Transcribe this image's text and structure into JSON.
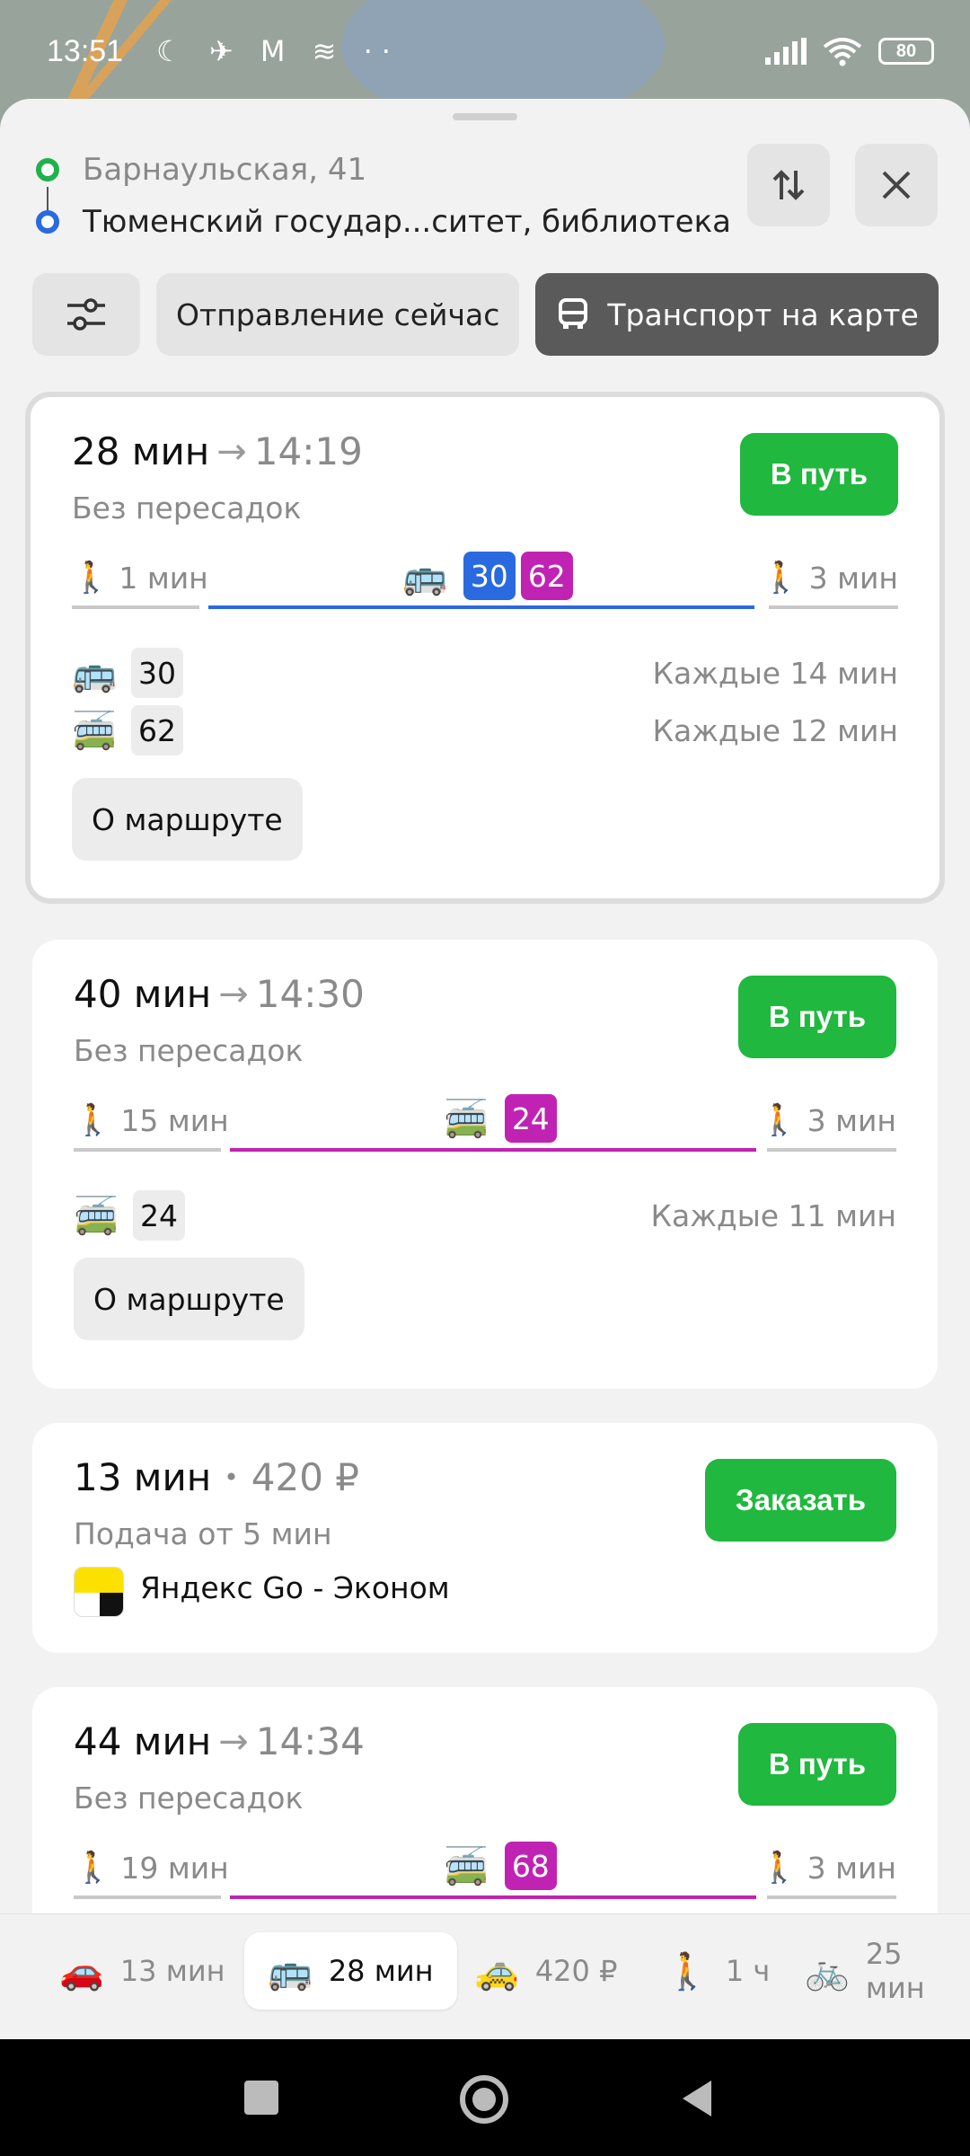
{
  "status_bar": {
    "time": "13:51",
    "left_icons": "☾ ✈ M ≋ ··",
    "battery": "80"
  },
  "route": {
    "from": "Барнаульская, 41",
    "to": "Тюменский государ...ситет, библиотека"
  },
  "icons": {
    "swap": "swap-vertical-icon",
    "close": "close-icon",
    "filters": "filters-icon",
    "bus": "bus-icon",
    "trolleybus": "trolleybus-icon",
    "walk": "walk-icon",
    "car": "car-icon",
    "taxi": "taxi-icon",
    "bike": "bike-icon"
  },
  "chips": {
    "departure": "Отправление сейчас",
    "transport_on_map": "Транспорт на карте"
  },
  "colors": {
    "go_green": "#20b83e",
    "bus_blue": "#2a6ae0",
    "trolley_purple": "#c023b3"
  },
  "cards": [
    {
      "duration": "28 мин",
      "arrival": "14:19",
      "subtitle": "Без пересадок",
      "go_label": "В путь",
      "walk_start": "1 мин",
      "walk_end": "3 мин",
      "badges": [
        "30",
        "62"
      ],
      "freq": [
        {
          "route": "30",
          "interval": "Каждые 14 мин"
        },
        {
          "route": "62",
          "interval": "Каждые 12 мин"
        }
      ],
      "about_label": "О маршруте"
    },
    {
      "duration": "40 мин",
      "arrival": "14:30",
      "subtitle": "Без пересадок",
      "go_label": "В путь",
      "walk_start": "15 мин",
      "walk_end": "3 мин",
      "badges": [
        "24"
      ],
      "freq": [
        {
          "route": "24",
          "interval": "Каждые 11 мин"
        }
      ],
      "about_label": "О маршруте"
    },
    {
      "duration": "13 мин",
      "price": "420 ₽",
      "subtitle": "Подача от 5 мин",
      "order_label": "Заказать",
      "service": "Яндекс Go - Эконом"
    },
    {
      "duration": "44 мин",
      "arrival": "14:34",
      "subtitle": "Без пересадок",
      "go_label": "В путь",
      "walk_start": "19 мин",
      "walk_end": "3 мин",
      "badges": [
        "68"
      ]
    }
  ],
  "tabs": [
    {
      "label": "13 мин",
      "icon": "car-icon"
    },
    {
      "label": "28 мин",
      "icon": "bus-icon",
      "active": true
    },
    {
      "label": "420 ₽",
      "icon": "taxi-icon"
    },
    {
      "label": "1 ч",
      "icon": "walk-icon"
    },
    {
      "label": "25 мин",
      "icon": "bike-icon"
    }
  ]
}
